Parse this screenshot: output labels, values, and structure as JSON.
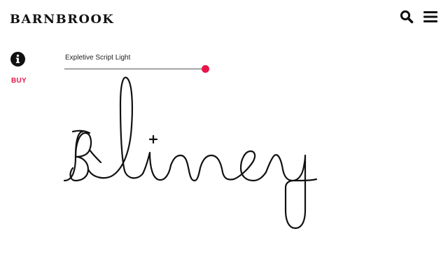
{
  "header": {
    "logo_text": "BARNBROOK",
    "icons": [
      "search-icon",
      "menu-icon"
    ]
  },
  "sidebar": {
    "info_icon": "info-icon",
    "buy_label": "BUY"
  },
  "font_tester": {
    "font_name": "Expletive Script Light",
    "size_slider_level": 1.0,
    "sample_text": "Bliney"
  },
  "colors": {
    "accent": "#e8174a",
    "text": "#111111",
    "background": "#ffffff"
  }
}
